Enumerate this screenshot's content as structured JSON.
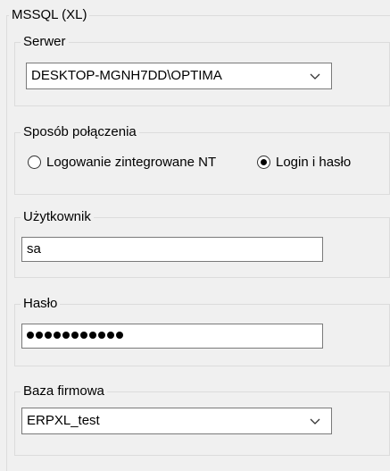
{
  "mssql": {
    "title": "MSSQL (XL)"
  },
  "server": {
    "label": "Serwer",
    "value": "DESKTOP-MGNH7DD\\OPTIMA"
  },
  "connection": {
    "label": "Sposób połączenia",
    "options": [
      {
        "label": "Logowanie zintegrowane NT",
        "selected": false
      },
      {
        "label": "Login i hasło",
        "selected": true
      }
    ]
  },
  "user": {
    "label": "Użytkownik",
    "value": "sa"
  },
  "password": {
    "label": "Hasło",
    "masked_length": 11
  },
  "company_db": {
    "label": "Baza firmowa",
    "value": "ERPXL_test"
  }
}
